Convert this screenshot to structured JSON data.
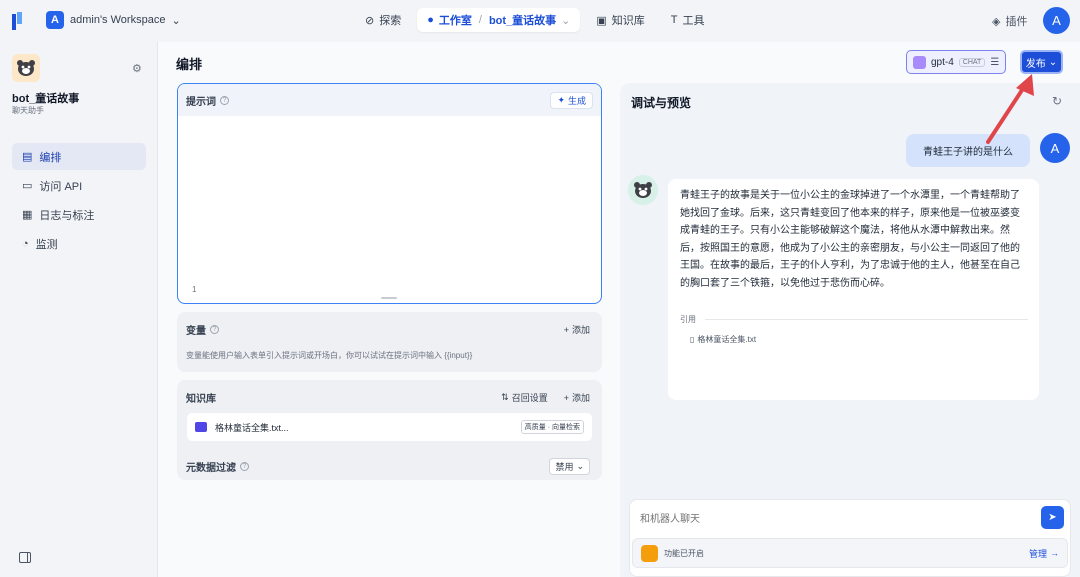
{
  "topbar": {
    "workspace_initial": "A",
    "workspace_name": "admin's Workspace",
    "nav": [
      {
        "label": "探索"
      },
      {
        "label": "工作室"
      },
      {
        "label": "bot_童话故事"
      },
      {
        "label": "知识库"
      },
      {
        "label": "工具"
      }
    ],
    "plugins_label": "插件",
    "user_initial": "A"
  },
  "sidebar": {
    "bot_name": "bot_童话故事",
    "bot_type": "聊天助手",
    "items": [
      {
        "label": "编排",
        "active": true
      },
      {
        "label": "访问 API"
      },
      {
        "label": "日志与标注"
      },
      {
        "label": "监测"
      }
    ]
  },
  "editor": {
    "title": "编排",
    "prompt": {
      "label": "提示词",
      "generate_label": "生成",
      "line_number": "1"
    },
    "variables": {
      "label": "变量",
      "add_label": "添加",
      "description": "变量能使用户输入表单引入提示词或开场白，你可以试试在提示词中输入 {{input}}"
    },
    "knowledge": {
      "label": "知识库",
      "recall_label": "召回设置",
      "add_label": "添加",
      "file_name": "格林童话全集.txt...",
      "file_tag": "高质量 · 向量检索"
    },
    "metadata": {
      "label": "元数据过滤",
      "select_value": "禁用"
    }
  },
  "toolbar": {
    "model_name": "gpt-4",
    "model_tag": "CHAT",
    "publish_label": "发布"
  },
  "preview": {
    "title": "调试与预览",
    "user_message": "青蛙王子讲的是什么",
    "user_initial": "A",
    "bot_message": "青蛙王子的故事是关于一位小公主的金球掉进了一个水潭里，一个青蛙帮助了她找回了金球。后来，这只青蛙变回了他本来的样子，原来他是一位被巫婆变成青蛙的王子。只有小公主能够破解这个魔法，将他从水潭中解救出来。然后，按照国王的意愿，他成为了小公主的亲密朋友，与小公主一同返回了他的王国。在故事的最后，王子的仆人亨利，为了忠诚于他的主人，他甚至在自己的胸口套了三个铁箍，以免他过于悲伤而心碎。",
    "citation_label": "引用",
    "citation_file": "格林童话全集.txt",
    "input_placeholder": "和机器人聊天",
    "feature_status": "功能已开启",
    "manage_label": "管理"
  },
  "colors": {
    "accent": "#1d4ed8",
    "arrow": "#e0454a"
  }
}
